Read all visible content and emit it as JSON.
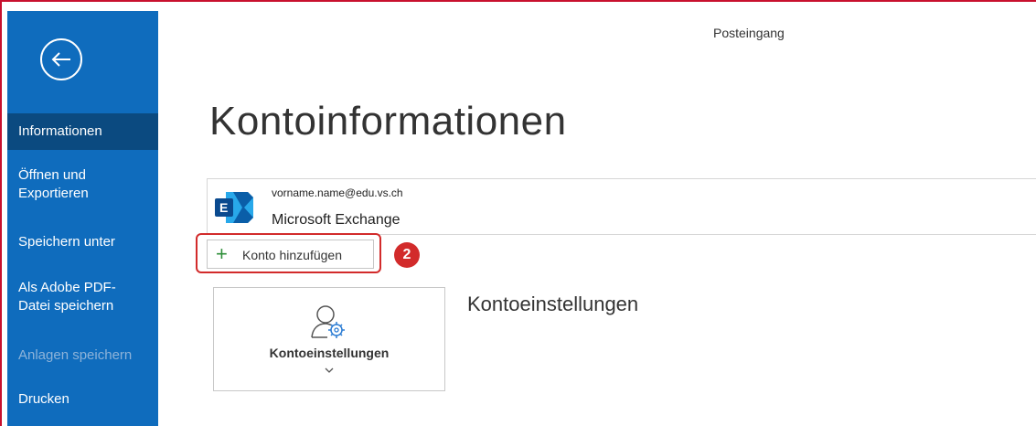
{
  "window": {
    "title": "Posteingang"
  },
  "sidebar": {
    "items": [
      {
        "label": "Informationen"
      },
      {
        "label": "Öffnen und"
      },
      {
        "label": "Exportieren"
      },
      {
        "label": "Speichern unter"
      },
      {
        "label": "Als Adobe PDF-"
      },
      {
        "label": "Datei speichern"
      },
      {
        "label": "Anlagen speichern"
      },
      {
        "label": "Drucken"
      }
    ]
  },
  "main": {
    "title": "Kontoinformationen",
    "account": {
      "email": "vorname.name@edu.vs.ch",
      "type": "Microsoft Exchange"
    },
    "add_account_label": "Konto hinzufügen",
    "step_badge": "2",
    "settings_tile_label": "Kontoeinstellungen",
    "settings_heading": "Kontoeinstellungen"
  },
  "colors": {
    "sidebar": "#0f6cbd",
    "sidebar_active": "#0b4a80",
    "highlight": "#d22b2b",
    "plus": "#2f8f3a"
  }
}
